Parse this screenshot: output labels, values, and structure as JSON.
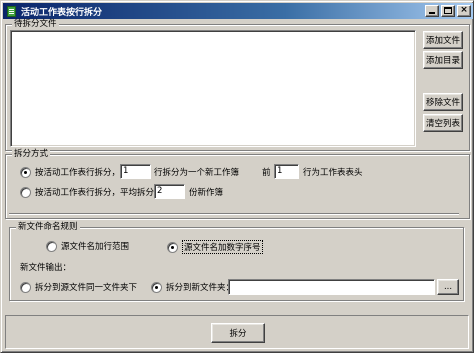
{
  "window": {
    "title": "活动工作表按行拆分",
    "minimize_label": "_",
    "maximize_label": "",
    "close_label": "×"
  },
  "files_group": {
    "label": "待拆分文件",
    "items": [],
    "add_file_label": "添加文件",
    "add_dir_label": "添加目录",
    "remove_file_label": "移除文件",
    "clear_list_label": "清空列表"
  },
  "split_group": {
    "label": "拆分方式",
    "option1": {
      "label": "按活动工作表行拆分，每",
      "rows_value": "1",
      "rows_suffix": "行拆分为一个新工作簿",
      "header_prefix": "前",
      "header_value": "1",
      "header_suffix": "行为工作表表头",
      "checked": true
    },
    "option2": {
      "label": "按活动工作表行拆分，平均拆分为",
      "parts_value": "2",
      "parts_suffix": "份新作簿",
      "checked": false
    }
  },
  "naming_group": {
    "label": "新文件命名规则",
    "range_option": "源文件名加行范围",
    "seq_option": "源文件名加数字序号",
    "selected": "seq",
    "output_label": "新文件输出：",
    "same_folder_option": "拆分到源文件同一文件夹下",
    "new_folder_option": "拆分到新文件夹：",
    "output_selected": "new_folder",
    "folder_path": "",
    "browse_label": "..."
  },
  "actions": {
    "split_label": "拆分"
  }
}
